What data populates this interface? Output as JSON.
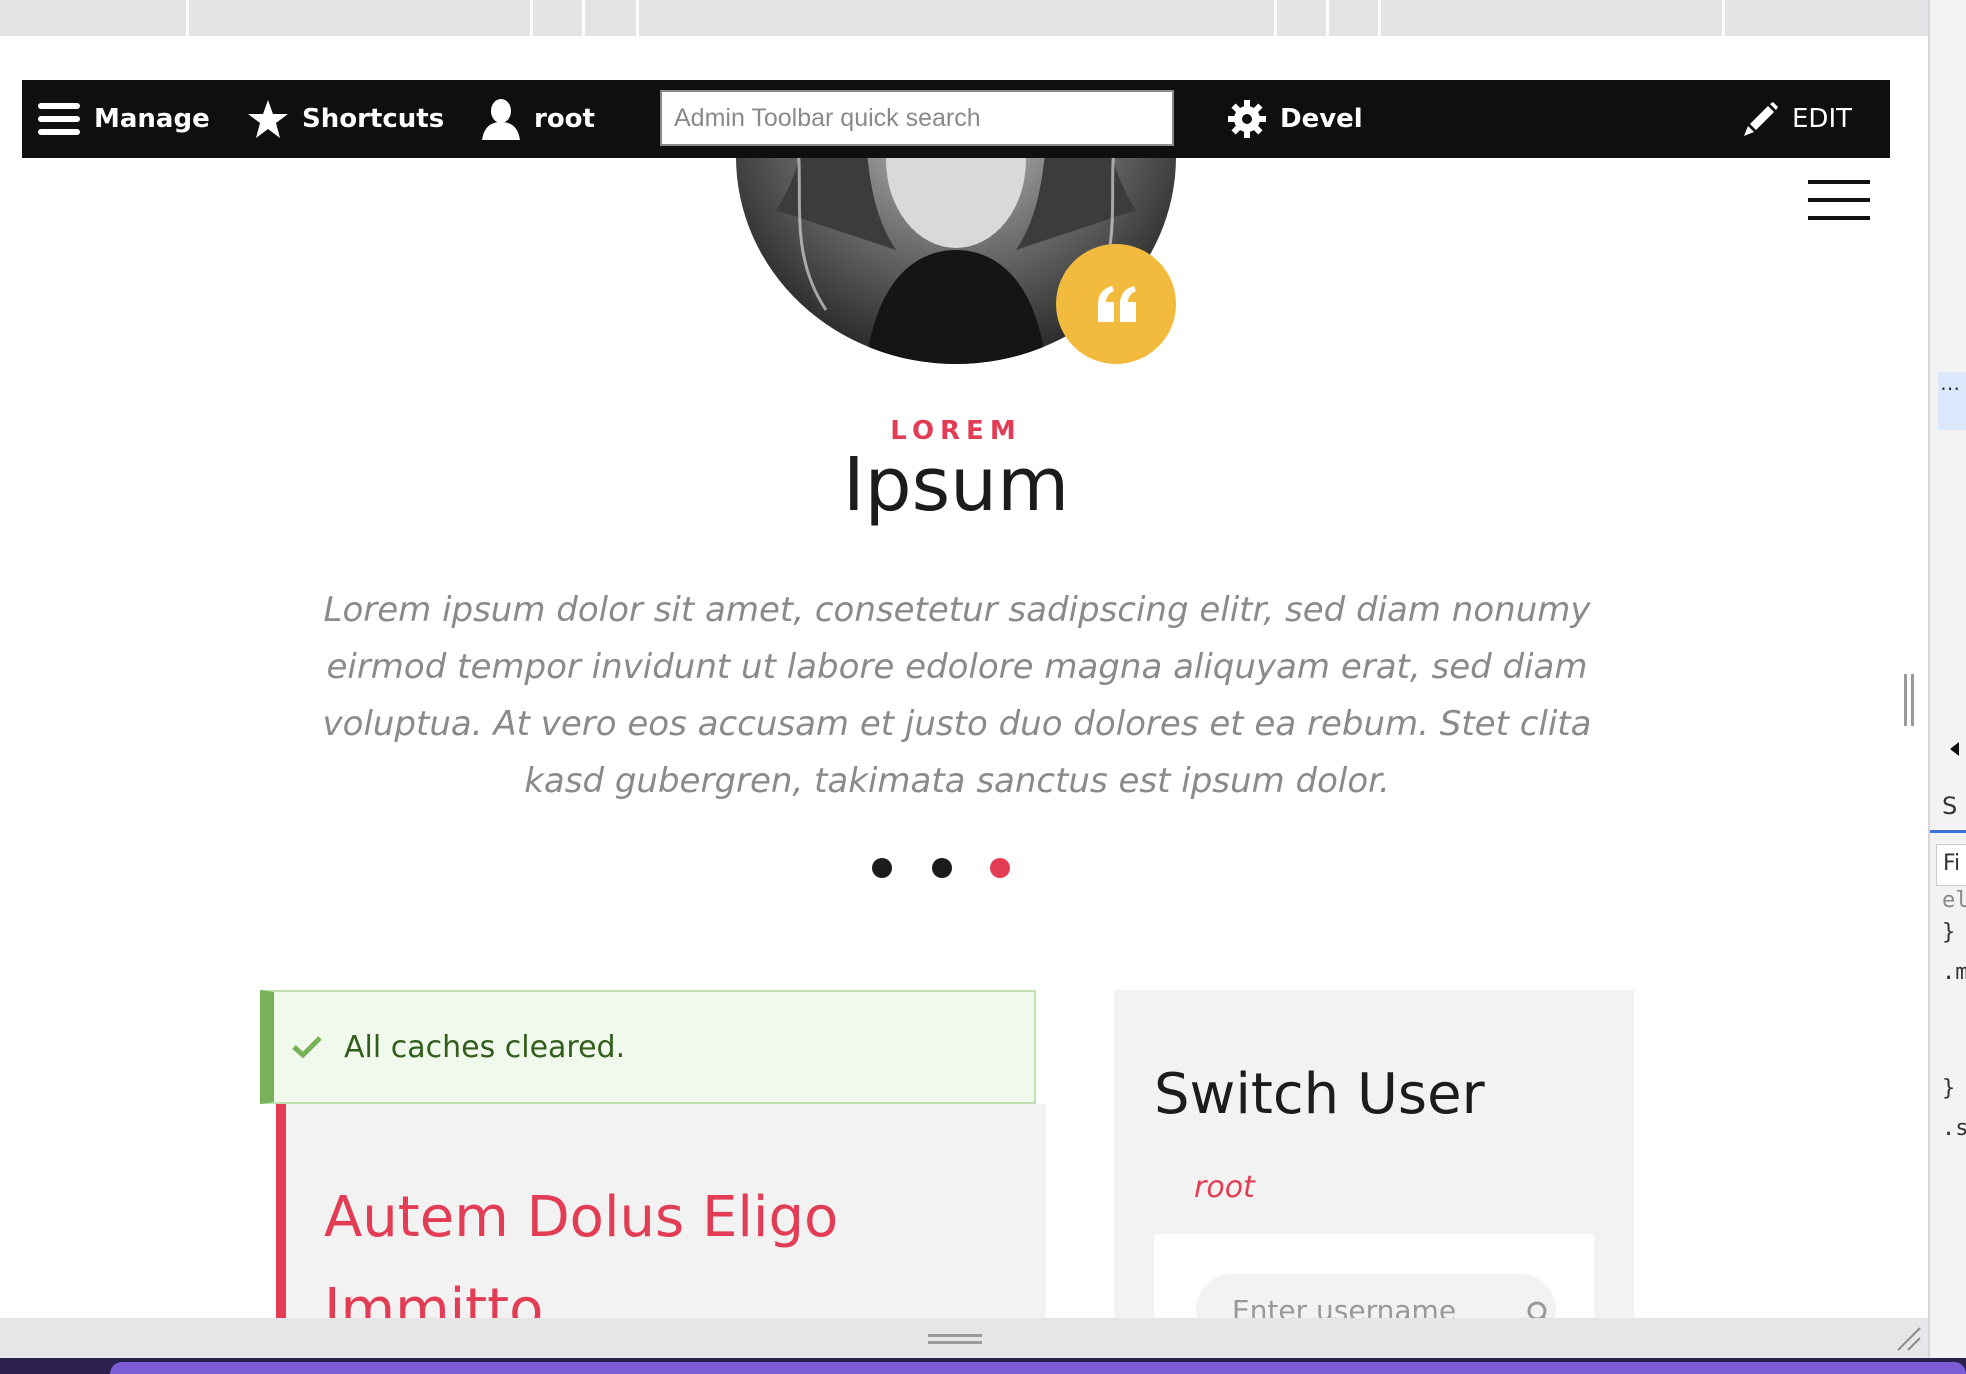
{
  "toolbar": {
    "manage_label": "Manage",
    "shortcuts_label": "Shortcuts",
    "user_label": "root",
    "search_placeholder": "Admin Toolbar quick search",
    "devel_label": "Devel",
    "edit_label": "EDIT",
    "icons": {
      "manage": "hamburger-menu-icon",
      "shortcuts": "star-icon",
      "user": "user-icon",
      "devel": "gear-icon",
      "edit": "pencil-icon"
    }
  },
  "testimonial": {
    "eyebrow": "LOREM",
    "headline": "Ipsum",
    "quote": "Lorem ipsum dolor sit amet, consetetur sadipscing elitr, sed diam nonumy eirmod tempor invidunt ut labore edolore magna aliquyam erat, sed diam voluptua. At vero eos accusam et justo duo dolores et ea rebum. Stet clita kasd gubergren, takimata sanctus est ipsum dolor.",
    "carousel": {
      "count": 3,
      "active_index": 2
    }
  },
  "status_message": {
    "text": "All caches cleared."
  },
  "article": {
    "title": "Autem Dolus Eligo Immitto"
  },
  "switch_user": {
    "title": "Switch User",
    "current_user": "root",
    "input_placeholder": "Enter username"
  },
  "devtools": {
    "tab_label": "S",
    "filter_label": "Fi",
    "code_lines": [
      "el",
      "}",
      ".m",
      "}",
      ".s"
    ]
  },
  "colors": {
    "accent": "#e23d55",
    "badge": "#f2bb3e",
    "success": "#77b259",
    "toolbar_bg": "#0f0f0f"
  }
}
